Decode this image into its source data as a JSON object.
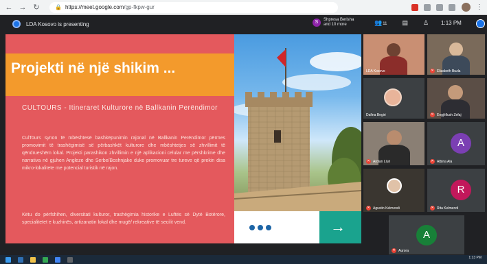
{
  "browser": {
    "back_icon": "back-arrow-icon",
    "url_host": "https://meet.google.com",
    "url_path": "/gp-fkpw-gur",
    "menu_icon": "more-vert-icon"
  },
  "meet": {
    "presenting_text": "LDA Kosovo is presenting",
    "participants_chip_letter": "S",
    "participants_chip_line1": "Shpresa Berisha",
    "participants_chip_line2": "and 10 more",
    "time": "1:13 PM"
  },
  "slide": {
    "title": "Projekti në një shikim ...",
    "subtitle": "CULTOURS - Itineraret Kulturore në Ballkanin Perëndimor",
    "body": "CulTours synon të mbështesë bashkëpunimin rajonal në Ballkanin Perëndimor përmes promovimit të trashëgimisë së përbashkët kulturore dhe mbështetjes së zhvillimit të qëndrueshëm lokal. Projekti parashikon zhvillimin e një aplikacioni celular me përshkrime dhe narrativa në gjuhen Angleze dhe Serbe/Boshnjake duke promovuar tre tureve që prekin disa mikro-lokalitete me potencial turistik në rajon.",
    "body2": "Këtu do përfshihen, diversitati kulturor, trashëgimia historike e Luftës së Dytë Botërore, specialitetet e kuzhinës, artizanatin lokal dhe mugë/ rekreative të secilit vend.",
    "next_arrow": "→"
  },
  "participants": [
    {
      "name": "LDA Kosovo",
      "muted": false
    },
    {
      "name": "Elizabeth Buzla",
      "muted": true
    },
    {
      "name": "Dafina Begiri",
      "muted": false
    },
    {
      "name": "Engjëllush Zefaj",
      "muted": true
    },
    {
      "name": "Ardian Lluri",
      "muted": true
    },
    {
      "name": "Albina Ala",
      "muted": true,
      "avatar_letter": "A"
    },
    {
      "name": "Agustin Kelmendi",
      "muted": true
    },
    {
      "name": "Rita Kelmendi",
      "muted": true,
      "avatar_letter": "R"
    },
    {
      "name": "Aurora",
      "muted": true,
      "avatar_letter": "A"
    }
  ],
  "taskbar": {
    "time": "1:13 PM"
  }
}
